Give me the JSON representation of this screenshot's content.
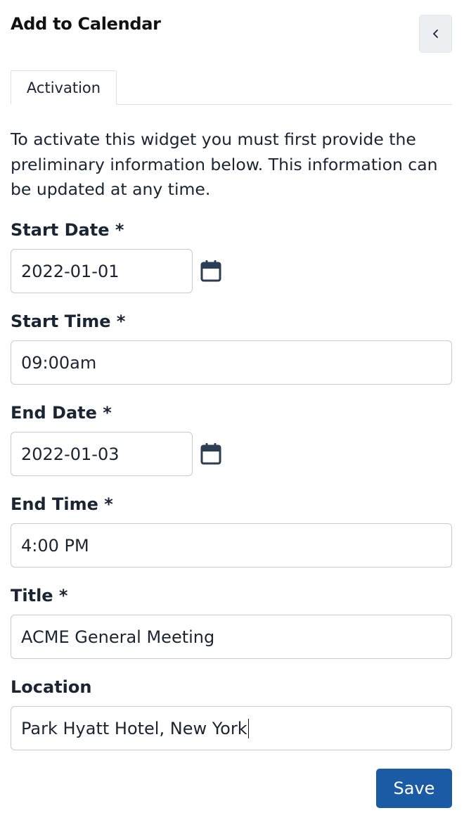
{
  "header": {
    "title": "Add to Calendar",
    "back_icon": "chevron-left-icon"
  },
  "tabs": [
    {
      "label": "Activation",
      "active": true
    }
  ],
  "intro": "To activate this widget you must first provide the preliminary information below. This information can be updated at any time.",
  "form": {
    "start_date": {
      "label": "Start Date *",
      "value": "2022-01-01",
      "icon": "calendar-icon"
    },
    "start_time": {
      "label": "Start Time *",
      "value": "09:00am"
    },
    "end_date": {
      "label": "End Date *",
      "value": "2022-01-03",
      "icon": "calendar-icon"
    },
    "end_time": {
      "label": "End Time *",
      "value": "4:00 PM"
    },
    "title": {
      "label": "Title *",
      "value": "ACME General Meeting"
    },
    "location": {
      "label": "Location",
      "value": "Park Hyatt Hotel, New York",
      "focused": true
    }
  },
  "actions": {
    "save_label": "Save"
  },
  "colors": {
    "primary": "#1b5aa5",
    "text": "#1a2433",
    "border": "#c4cbd3",
    "icon": "#2c3e55"
  }
}
